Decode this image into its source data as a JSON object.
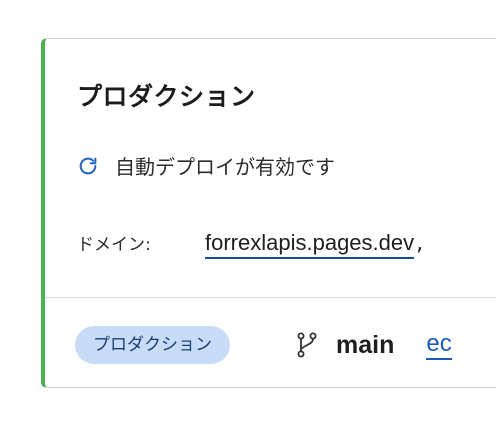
{
  "deployment": {
    "title": "プロダクション",
    "status_text": "自動デプロイが有効です",
    "status_icon": "refresh-icon",
    "domain_label": "ドメイン:",
    "domain_value": "forrexlapis.pages.dev",
    "domain_separator": ",",
    "environment_badge": "プロダクション",
    "branch_icon": "git-branch-icon",
    "branch_name": "main",
    "commit_link": "ec"
  },
  "colors": {
    "accent_bar": "#4caf50",
    "badge_bg": "#c9dcf7",
    "link": "#1a5bb8",
    "status_icon": "#2563c4"
  }
}
